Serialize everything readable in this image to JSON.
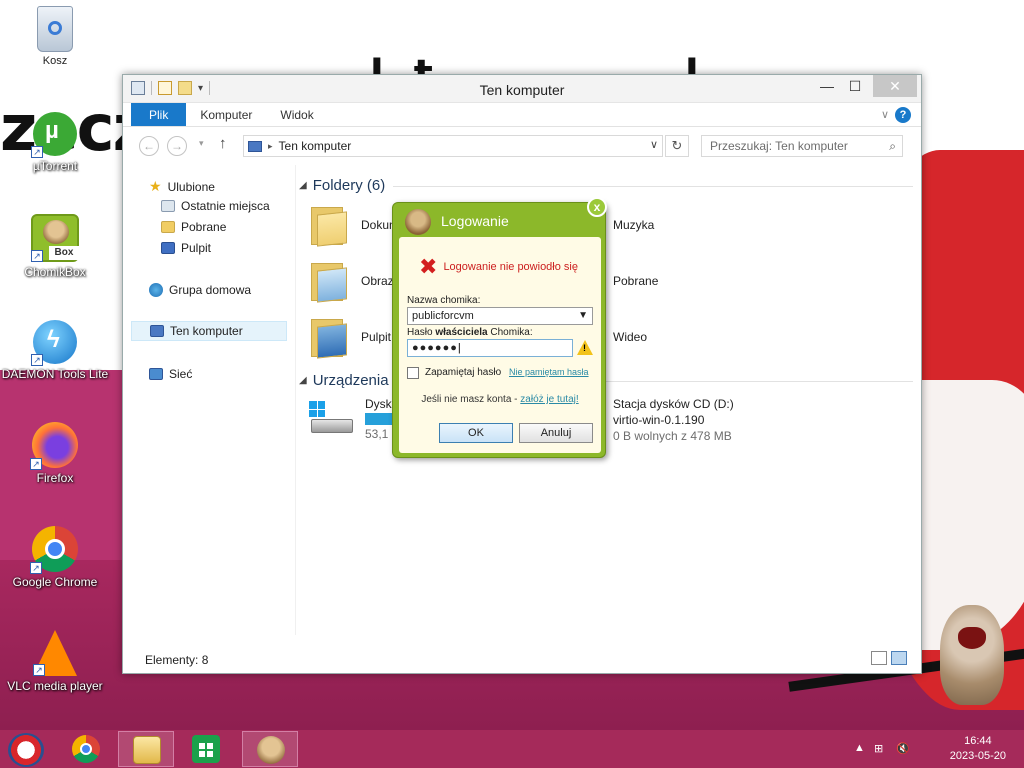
{
  "desktop": {
    "icons": [
      {
        "label": "Kosz"
      },
      {
        "label": "µTorrent"
      },
      {
        "label": "ChomikBox"
      },
      {
        "label": "DAEMON Tools Lite"
      },
      {
        "label": "Firefox"
      },
      {
        "label": "Google Chrome"
      },
      {
        "label": "VLC media player"
      }
    ]
  },
  "explorer": {
    "title": "Ten komputer",
    "ribbon_tabs": [
      "Plik",
      "Komputer",
      "Widok"
    ],
    "address": "Ten komputer",
    "search_placeholder": "Przeszukaj: Ten komputer",
    "nav": {
      "favorites": "Ulubione",
      "favorites_items": [
        "Ostatnie miejsca",
        "Pobrane",
        "Pulpit"
      ],
      "homegroup": "Grupa domowa",
      "this_pc": "Ten komputer",
      "network": "Sieć"
    },
    "folders_header": "Foldery (6)",
    "folders": [
      "Dokun",
      "Muzyka",
      "Obraz",
      "Pobrane",
      "Pulpit",
      "Wideo"
    ],
    "devices_header": "Urządzenia i",
    "disk": {
      "name": "Dysk l",
      "free": "53,1 G"
    },
    "cd": {
      "name": "Stacja dysków CD (D:)",
      "label": "virtio-win-0.1.190",
      "free": "0 B wolnych z 478 MB"
    },
    "status": "Elementy: 8"
  },
  "login": {
    "title": "Logowanie",
    "close": "x",
    "error": "Logowanie nie powiodło się",
    "user_label": "Nazwa chomika:",
    "user_value": "publicforcvm",
    "pw_label_pre": "Hasło ",
    "pw_label_bold": "właściciela",
    "pw_label_post": " Chomika:",
    "pw_value": "●●●●●●",
    "remember": "Zapamiętaj hasło",
    "forgot": "Nie pamiętam hasła",
    "no_account": "Jeśli nie masz konta - ",
    "signup": "załóż je tutaj!",
    "ok": "OK",
    "cancel": "Anuluj"
  },
  "taskbar": {
    "time": "16:44",
    "date": "2023-05-20"
  }
}
